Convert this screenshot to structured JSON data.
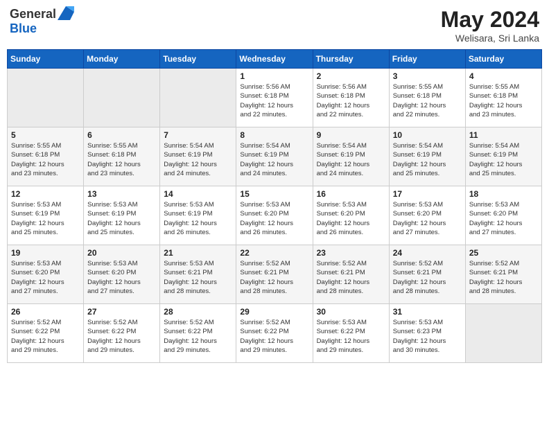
{
  "header": {
    "logo_general": "General",
    "logo_blue": "Blue",
    "month": "May 2024",
    "location": "Welisara, Sri Lanka"
  },
  "weekdays": [
    "Sunday",
    "Monday",
    "Tuesday",
    "Wednesday",
    "Thursday",
    "Friday",
    "Saturday"
  ],
  "weeks": [
    [
      {
        "day": "",
        "info": ""
      },
      {
        "day": "",
        "info": ""
      },
      {
        "day": "",
        "info": ""
      },
      {
        "day": "1",
        "info": "Sunrise: 5:56 AM\nSunset: 6:18 PM\nDaylight: 12 hours\nand 22 minutes."
      },
      {
        "day": "2",
        "info": "Sunrise: 5:56 AM\nSunset: 6:18 PM\nDaylight: 12 hours\nand 22 minutes."
      },
      {
        "day": "3",
        "info": "Sunrise: 5:55 AM\nSunset: 6:18 PM\nDaylight: 12 hours\nand 22 minutes."
      },
      {
        "day": "4",
        "info": "Sunrise: 5:55 AM\nSunset: 6:18 PM\nDaylight: 12 hours\nand 23 minutes."
      }
    ],
    [
      {
        "day": "5",
        "info": "Sunrise: 5:55 AM\nSunset: 6:18 PM\nDaylight: 12 hours\nand 23 minutes."
      },
      {
        "day": "6",
        "info": "Sunrise: 5:55 AM\nSunset: 6:18 PM\nDaylight: 12 hours\nand 23 minutes."
      },
      {
        "day": "7",
        "info": "Sunrise: 5:54 AM\nSunset: 6:19 PM\nDaylight: 12 hours\nand 24 minutes."
      },
      {
        "day": "8",
        "info": "Sunrise: 5:54 AM\nSunset: 6:19 PM\nDaylight: 12 hours\nand 24 minutes."
      },
      {
        "day": "9",
        "info": "Sunrise: 5:54 AM\nSunset: 6:19 PM\nDaylight: 12 hours\nand 24 minutes."
      },
      {
        "day": "10",
        "info": "Sunrise: 5:54 AM\nSunset: 6:19 PM\nDaylight: 12 hours\nand 25 minutes."
      },
      {
        "day": "11",
        "info": "Sunrise: 5:54 AM\nSunset: 6:19 PM\nDaylight: 12 hours\nand 25 minutes."
      }
    ],
    [
      {
        "day": "12",
        "info": "Sunrise: 5:53 AM\nSunset: 6:19 PM\nDaylight: 12 hours\nand 25 minutes."
      },
      {
        "day": "13",
        "info": "Sunrise: 5:53 AM\nSunset: 6:19 PM\nDaylight: 12 hours\nand 25 minutes."
      },
      {
        "day": "14",
        "info": "Sunrise: 5:53 AM\nSunset: 6:19 PM\nDaylight: 12 hours\nand 26 minutes."
      },
      {
        "day": "15",
        "info": "Sunrise: 5:53 AM\nSunset: 6:20 PM\nDaylight: 12 hours\nand 26 minutes."
      },
      {
        "day": "16",
        "info": "Sunrise: 5:53 AM\nSunset: 6:20 PM\nDaylight: 12 hours\nand 26 minutes."
      },
      {
        "day": "17",
        "info": "Sunrise: 5:53 AM\nSunset: 6:20 PM\nDaylight: 12 hours\nand 27 minutes."
      },
      {
        "day": "18",
        "info": "Sunrise: 5:53 AM\nSunset: 6:20 PM\nDaylight: 12 hours\nand 27 minutes."
      }
    ],
    [
      {
        "day": "19",
        "info": "Sunrise: 5:53 AM\nSunset: 6:20 PM\nDaylight: 12 hours\nand 27 minutes."
      },
      {
        "day": "20",
        "info": "Sunrise: 5:53 AM\nSunset: 6:20 PM\nDaylight: 12 hours\nand 27 minutes."
      },
      {
        "day": "21",
        "info": "Sunrise: 5:53 AM\nSunset: 6:21 PM\nDaylight: 12 hours\nand 28 minutes."
      },
      {
        "day": "22",
        "info": "Sunrise: 5:52 AM\nSunset: 6:21 PM\nDaylight: 12 hours\nand 28 minutes."
      },
      {
        "day": "23",
        "info": "Sunrise: 5:52 AM\nSunset: 6:21 PM\nDaylight: 12 hours\nand 28 minutes."
      },
      {
        "day": "24",
        "info": "Sunrise: 5:52 AM\nSunset: 6:21 PM\nDaylight: 12 hours\nand 28 minutes."
      },
      {
        "day": "25",
        "info": "Sunrise: 5:52 AM\nSunset: 6:21 PM\nDaylight: 12 hours\nand 28 minutes."
      }
    ],
    [
      {
        "day": "26",
        "info": "Sunrise: 5:52 AM\nSunset: 6:22 PM\nDaylight: 12 hours\nand 29 minutes."
      },
      {
        "day": "27",
        "info": "Sunrise: 5:52 AM\nSunset: 6:22 PM\nDaylight: 12 hours\nand 29 minutes."
      },
      {
        "day": "28",
        "info": "Sunrise: 5:52 AM\nSunset: 6:22 PM\nDaylight: 12 hours\nand 29 minutes."
      },
      {
        "day": "29",
        "info": "Sunrise: 5:52 AM\nSunset: 6:22 PM\nDaylight: 12 hours\nand 29 minutes."
      },
      {
        "day": "30",
        "info": "Sunrise: 5:53 AM\nSunset: 6:22 PM\nDaylight: 12 hours\nand 29 minutes."
      },
      {
        "day": "31",
        "info": "Sunrise: 5:53 AM\nSunset: 6:23 PM\nDaylight: 12 hours\nand 30 minutes."
      },
      {
        "day": "",
        "info": ""
      }
    ]
  ]
}
